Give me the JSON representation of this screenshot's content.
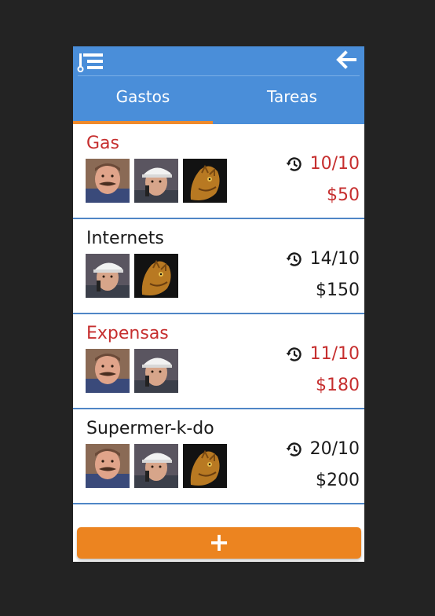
{
  "tabs": [
    {
      "label": "Gastos",
      "active": true
    },
    {
      "label": "Tareas",
      "active": false
    }
  ],
  "icons": {
    "menu": "list-menu-icon",
    "back": "arrow-left-icon",
    "history": "history-icon",
    "add": "plus-icon"
  },
  "colors": {
    "appbar": "#4a8ed9",
    "accent": "#ef8a2b",
    "alert": "#c62e2e",
    "divider": "#4f86c6"
  },
  "expenses": [
    {
      "name": "Gas",
      "date": "10/10",
      "amount": "$50",
      "overdue": true,
      "avatars": [
        "mustache-man",
        "cap-boy",
        "lizard"
      ]
    },
    {
      "name": "Internets",
      "date": "14/10",
      "amount": "$150",
      "overdue": false,
      "avatars": [
        "cap-boy",
        "lizard"
      ]
    },
    {
      "name": "Expensas",
      "date": "11/10",
      "amount": "$180",
      "overdue": true,
      "avatars": [
        "mustache-man",
        "cap-boy"
      ]
    },
    {
      "name": "Supermer-k-do",
      "date": "20/10",
      "amount": "$200",
      "overdue": false,
      "avatars": [
        "mustache-man",
        "cap-boy",
        "lizard"
      ]
    }
  ],
  "add_button": {
    "label": "+"
  }
}
